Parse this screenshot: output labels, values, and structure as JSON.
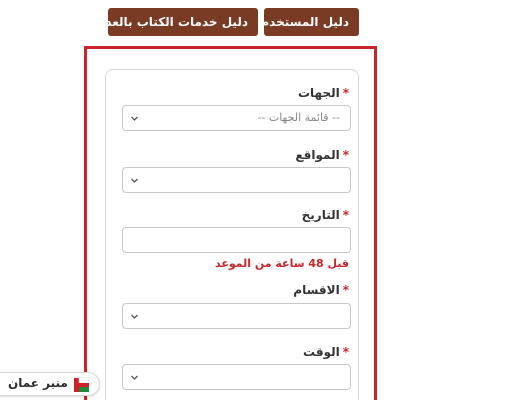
{
  "header": {
    "guide_services_label": "دليل خدمات الكتاب بالعدل",
    "user_guide_label": "دليل المستخدم"
  },
  "form": {
    "required_mark": "*",
    "entities": {
      "label": "الجهات",
      "placeholder": "-- قائمة الجهات --"
    },
    "locations": {
      "label": "المواقع"
    },
    "date": {
      "label": "التاريخ",
      "value": ""
    },
    "warning": "قبل 48 ساعة من الموعد",
    "departments": {
      "label": "الاقسام"
    },
    "time": {
      "label": "الوقت"
    }
  },
  "watermark": {
    "text": "منبر عمان",
    "logo_icon": "oman-flag-logo-icon"
  },
  "colors": {
    "button_bg": "#7a3b24",
    "frame_red": "#c9262c",
    "warning_red": "#c9262c"
  }
}
